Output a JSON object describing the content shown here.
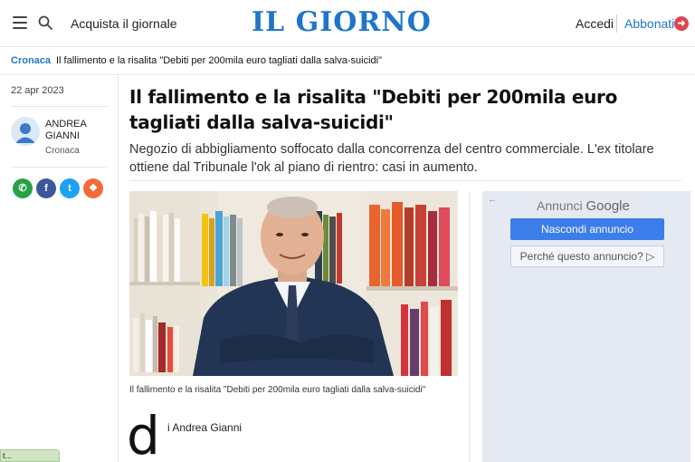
{
  "header": {
    "buy_label": "Acquista il giornale",
    "logo": "IL GIORNO",
    "login_label": "Accedi",
    "subscribe_label": "Abbonati",
    "brand_color": "#1f76c9",
    "icons": {
      "menu": "hamburger-menu-icon",
      "search": "search-icon",
      "subscribe": "arrow-right-icon"
    }
  },
  "breadcrumb": {
    "section": "Cronaca",
    "title": "Il fallimento e la risalita \"Debiti per 200mila euro tagliati dalla salva-suicidi\""
  },
  "sidebar": {
    "date": "22 apr 2023",
    "author": {
      "name": "ANDREA GIANNI",
      "section": "Cronaca"
    },
    "share": [
      {
        "name": "whatsapp",
        "glyph": "✆",
        "color": "#25a244"
      },
      {
        "name": "facebook",
        "glyph": "f",
        "color": "#3b5998"
      },
      {
        "name": "twitter",
        "glyph": "t",
        "color": "#1da1f2"
      },
      {
        "name": "gift",
        "glyph": "❖",
        "color": "#f26b3a"
      }
    ]
  },
  "article": {
    "title": "Il fallimento e la risalita \"Debiti per 200mila euro tagliati dalla salva-suicidi\"",
    "subtitle": "Negozio di abbigliamento soffocato dalla concorrenza del centro commerciale. L'ex titolare ottiene dal Tribunale l'ok al piano di rientro: casi in aumento.",
    "caption": "Il fallimento e la risalita \"Debiti per 200mila euro tagliati dalla salva-suicidi\"",
    "dropcap": "d",
    "byline": "i Andrea Gianni"
  },
  "ad": {
    "back": "←",
    "annunci": "Annunci",
    "google": "Google",
    "hide_label": "Nascondi annuncio",
    "why_label": "Perché questo annuncio? ▷"
  },
  "status": {
    "text": "t..."
  }
}
